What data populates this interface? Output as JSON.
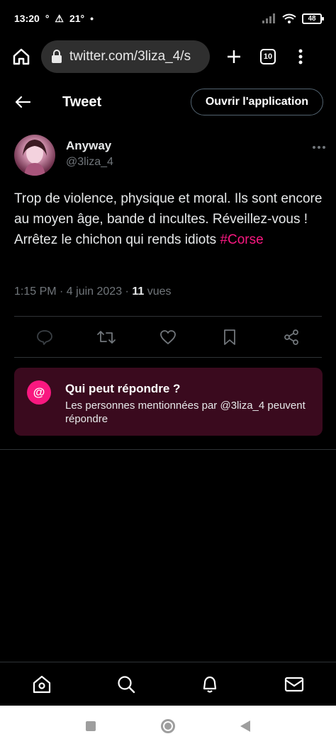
{
  "status_bar": {
    "time": "13:20",
    "notif": "21°",
    "temp": "21°",
    "battery": "48"
  },
  "browser": {
    "url": "twitter.com/3liza_4/s",
    "tab_count": "10"
  },
  "header": {
    "title": "Tweet",
    "open_app_label": "Ouvrir l'application"
  },
  "tweet": {
    "author_name": "Anyway",
    "author_handle": "@3liza_4",
    "text": "Trop de violence, physique et moral. Ils sont encore au moyen âge, bande d incultes. Réveillez-vous ! Arrêtez le chichon qui rends idiots ",
    "hashtag": "#Corse",
    "time": "1:15 PM · 4 juin 2023 · ",
    "views_count": "11",
    "views_label": "vues"
  },
  "reply_card": {
    "badge": "@",
    "title": "Qui peut répondre ?",
    "description": "Les personnes mentionnées par @3liza_4 peuvent répondre"
  },
  "icons": {
    "back": "arrow-left-icon",
    "home": "house-icon",
    "search": "magnifier-icon",
    "notifications": "bell-icon",
    "messages": "envelope-icon"
  },
  "colors": {
    "accent": "#f91880",
    "card_bg": "#3a0a1e",
    "muted": "#71767b"
  }
}
